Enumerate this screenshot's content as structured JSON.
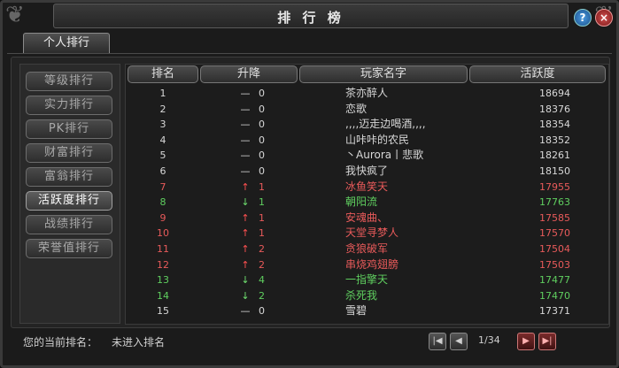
{
  "window": {
    "title": "排 行 榜"
  },
  "tabs": [
    {
      "label": "个人排行"
    }
  ],
  "sidebar": {
    "items": [
      {
        "label": "等级排行",
        "active": false
      },
      {
        "label": "实力排行",
        "active": false
      },
      {
        "label": "PK排行",
        "active": false
      },
      {
        "label": "财富排行",
        "active": false
      },
      {
        "label": "富翁排行",
        "active": false
      },
      {
        "label": "活跃度排行",
        "active": true
      },
      {
        "label": "战绩排行",
        "active": false
      },
      {
        "label": "荣誉值排行",
        "active": false
      }
    ]
  },
  "table": {
    "headers": {
      "rank": "排名",
      "change": "升降",
      "name": "玩家名字",
      "activity": "活跃度"
    },
    "rows": [
      {
        "rank": "1",
        "arrow": "—",
        "change": "0",
        "name": "茶亦醉人",
        "activity": "18694",
        "color": "white"
      },
      {
        "rank": "2",
        "arrow": "—",
        "change": "0",
        "name": "恋歌",
        "activity": "18376",
        "color": "white"
      },
      {
        "rank": "3",
        "arrow": "—",
        "change": "0",
        "name": ",,,,迈走边喝酒,,,,",
        "activity": "18354",
        "color": "white"
      },
      {
        "rank": "4",
        "arrow": "—",
        "change": "0",
        "name": "山咔咔的农民",
        "activity": "18352",
        "color": "white"
      },
      {
        "rank": "5",
        "arrow": "—",
        "change": "0",
        "name": "丶Aurora丨悲歌",
        "activity": "18261",
        "color": "white"
      },
      {
        "rank": "6",
        "arrow": "—",
        "change": "0",
        "name": "我快疯了",
        "activity": "18150",
        "color": "white"
      },
      {
        "rank": "7",
        "arrow": "↑",
        "change": "1",
        "name": "冰鱼笑天",
        "activity": "17955",
        "color": "red"
      },
      {
        "rank": "8",
        "arrow": "↓",
        "change": "1",
        "name": "朝阳流",
        "activity": "17763",
        "color": "green"
      },
      {
        "rank": "9",
        "arrow": "↑",
        "change": "1",
        "name": "安魂曲、",
        "activity": "17585",
        "color": "red"
      },
      {
        "rank": "10",
        "arrow": "↑",
        "change": "1",
        "name": "天堂寻梦人",
        "activity": "17570",
        "color": "red"
      },
      {
        "rank": "11",
        "arrow": "↑",
        "change": "2",
        "name": "贪狼破军",
        "activity": "17504",
        "color": "red"
      },
      {
        "rank": "12",
        "arrow": "↑",
        "change": "2",
        "name": "串烧鸡翅膀",
        "activity": "17503",
        "color": "red"
      },
      {
        "rank": "13",
        "arrow": "↓",
        "change": "4",
        "name": "一指擎天",
        "activity": "17477",
        "color": "green"
      },
      {
        "rank": "14",
        "arrow": "↓",
        "change": "2",
        "name": "杀死我",
        "activity": "17470",
        "color": "green"
      },
      {
        "rank": "15",
        "arrow": "—",
        "change": "0",
        "name": "雪碧",
        "activity": "17371",
        "color": "white"
      }
    ]
  },
  "footer": {
    "current_rank_label": "您的当前排名：",
    "current_rank_value": "未进入排名",
    "page": "1/34"
  },
  "icons": {
    "help": "help-icon",
    "close": "close-icon",
    "first": "first-page-icon",
    "prev": "prev-page-icon",
    "next": "next-page-icon",
    "last": "last-page-icon"
  },
  "colors": {
    "up": "#ff5050",
    "down": "#6fe06f",
    "neutral": "#d8d8d8"
  }
}
